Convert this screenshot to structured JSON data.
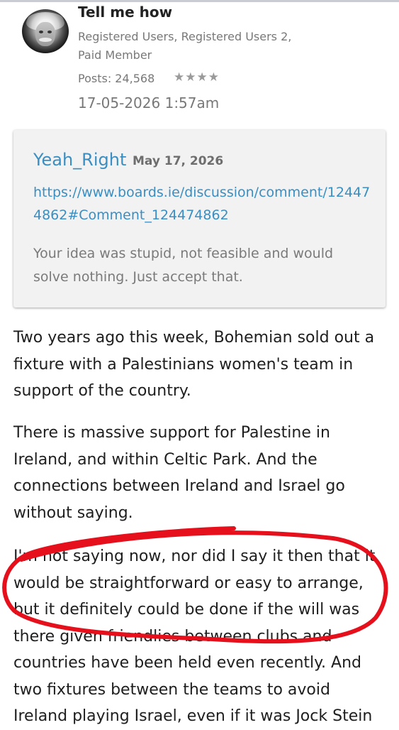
{
  "post": {
    "author": "Tell me how",
    "roles": "Registered Users, Registered Users 2, Paid Member",
    "posts": "Posts: 24,568",
    "stars": "★★★★",
    "timestamp": "17-05-2026 1:57am"
  },
  "quote": {
    "author": "Yeah_Right",
    "date": "May 17, 2026",
    "link": "https://www.boards.ie/discussion/comment/124474862#Comment_124474862",
    "text": "Your idea was stupid, not feasible and would solve nothing. Just accept that."
  },
  "body": {
    "p1": "Two years ago this week, Bohemian sold out a fixture with a Palestinians women's team in support of the country.",
    "p2": "There is massive support for Palestine in Ireland, and within Celtic Park. And the connections between Ireland and Israel go without saying.",
    "p3": "I'm not saying now, nor did I say it then that it would be straightforward or easy to arrange, but it definitely could be done if the will was there given friendlies between clubs and countries have been held even recently. And two fixtures between the teams to avoid Ireland playing Israel, even if it was Jock Stein"
  },
  "colors": {
    "link": "#3a8ec2",
    "annotation": "#e5101c"
  }
}
